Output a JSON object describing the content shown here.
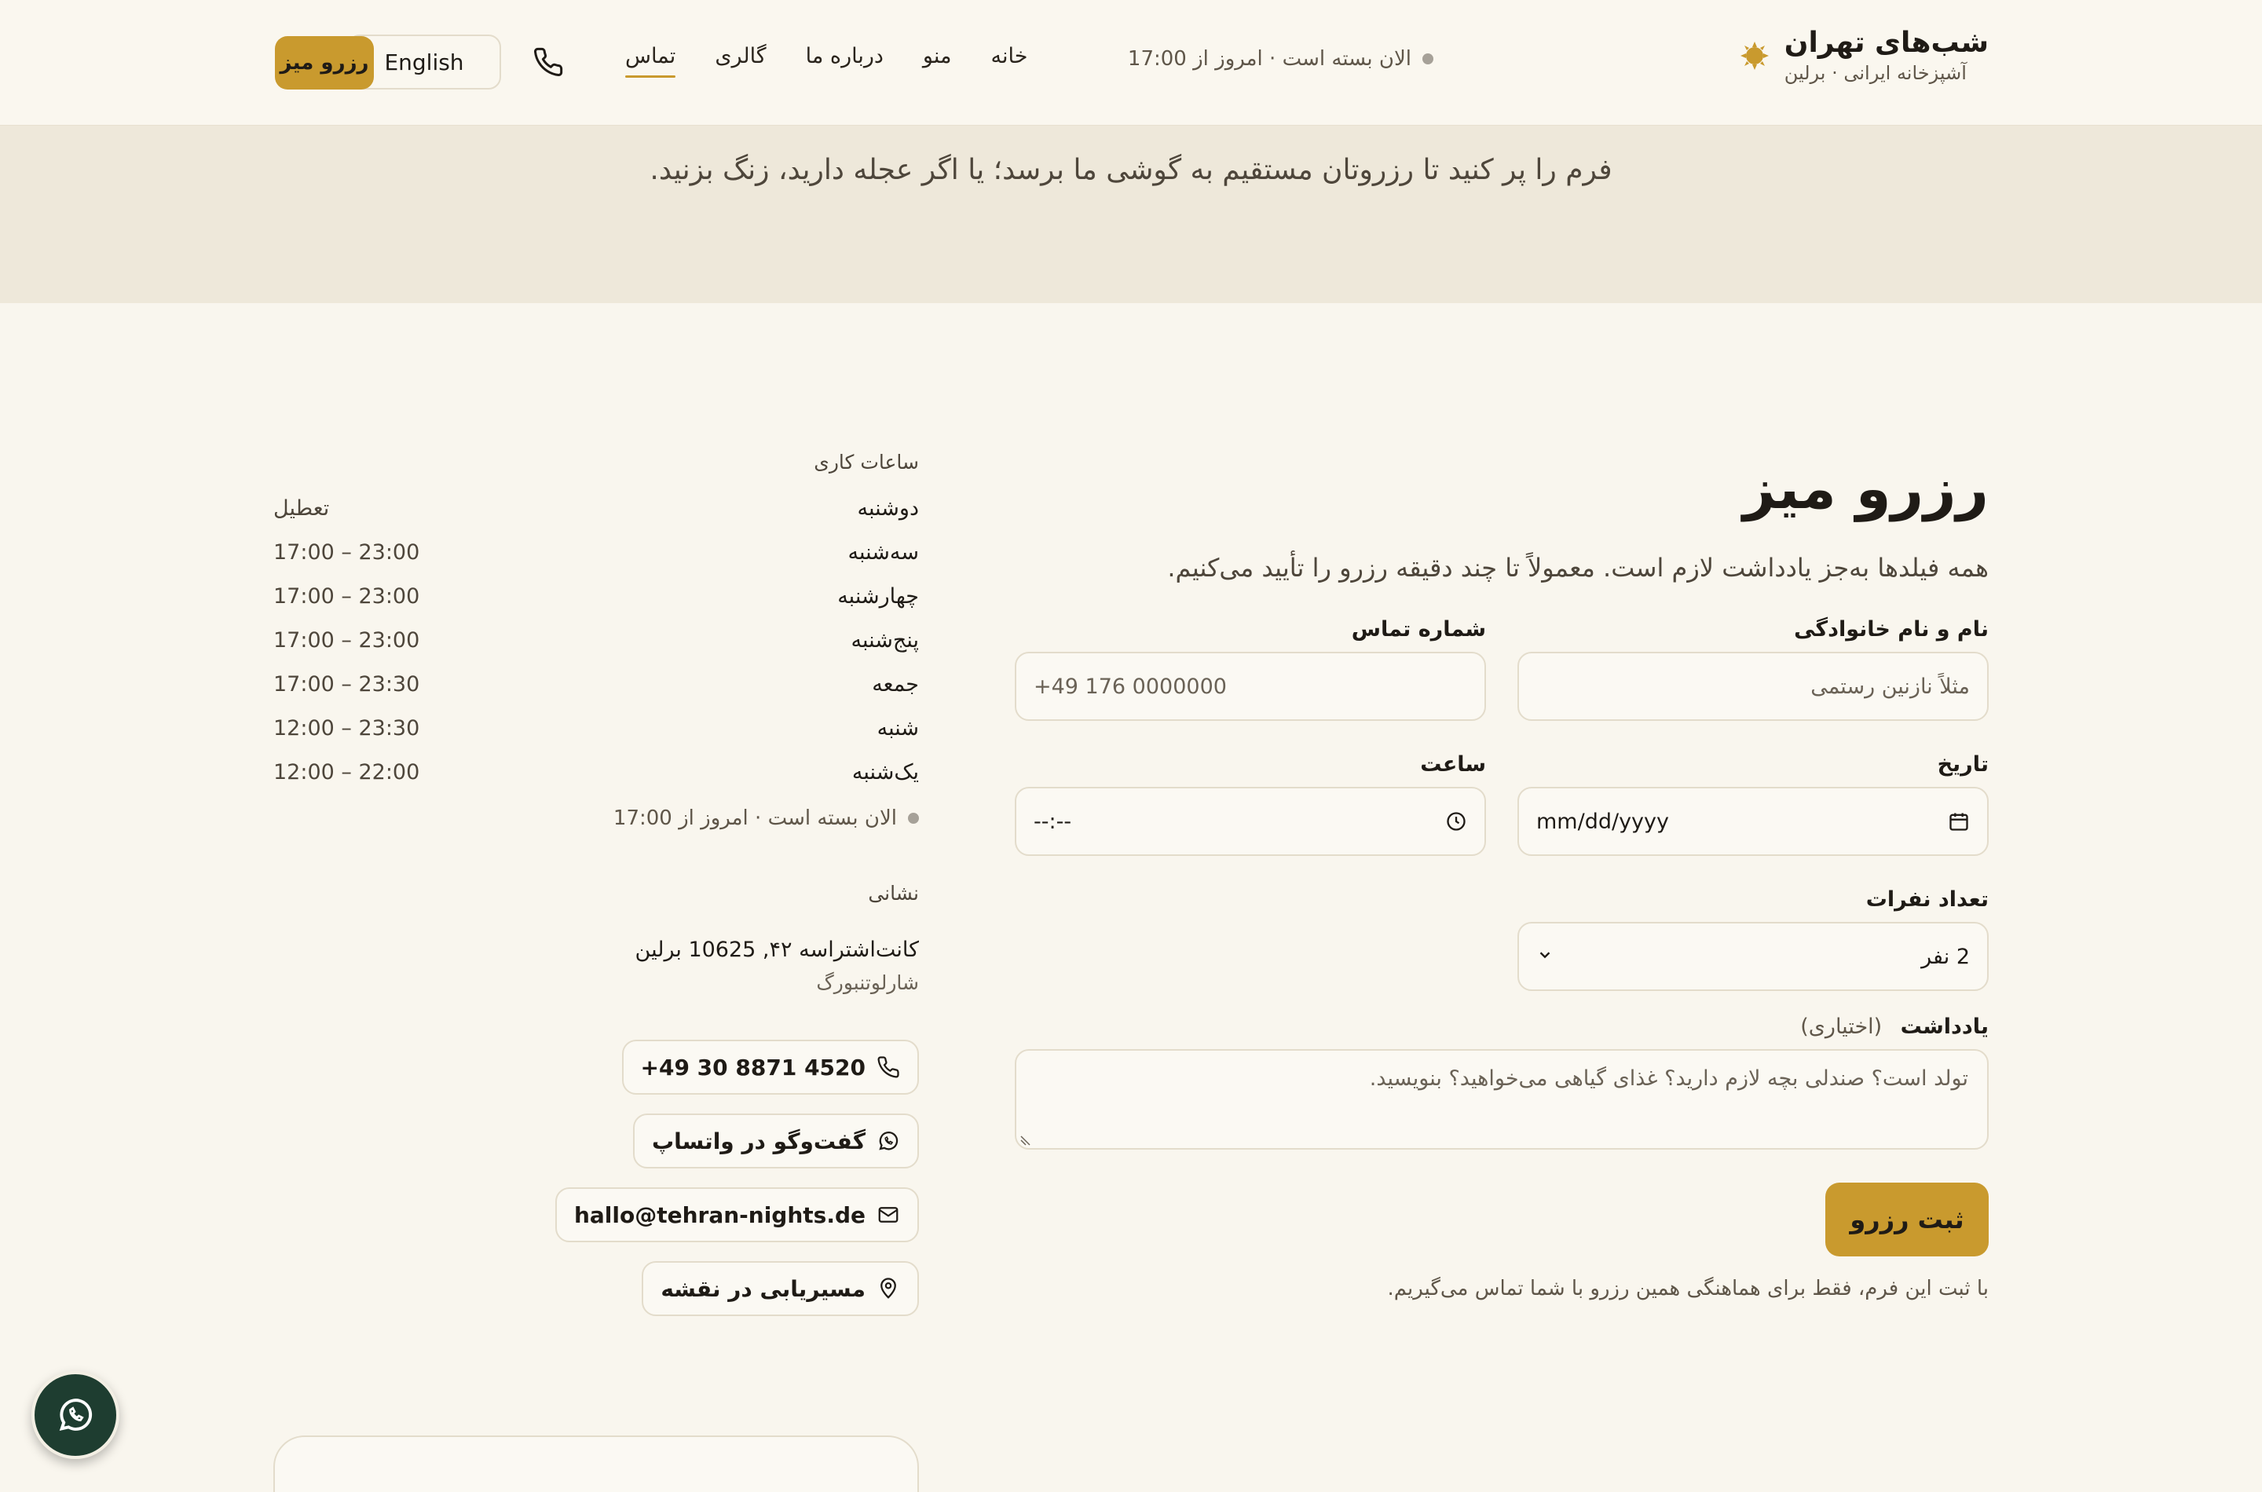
{
  "header": {
    "brand_name": "شب‌های تهران",
    "brand_sub": "آشپزخانه ایرانی · برلین",
    "status": "الان بسته است · امروز از 17:00",
    "nav": [
      {
        "label": "خانه"
      },
      {
        "label": "منو"
      },
      {
        "label": "درباره ما"
      },
      {
        "label": "گالری"
      },
      {
        "label": "تماس",
        "active": true
      }
    ],
    "lang_label": "English",
    "reserve_label": "رزرو میز"
  },
  "banner": {
    "text": "فرم را پر کنید تا رزروتان مستقیم به گوشی ما برسد؛ یا اگر عجله دارید، زنگ بزنید."
  },
  "form": {
    "title": "رزرو میز",
    "subtitle": "همه فیلدها به‌جز یادداشت لازم است. معمولاً تا چند دقیقه رزرو را تأیید می‌کنیم.",
    "name_label": "نام و نام خانوادگی",
    "name_placeholder": "مثلاً نازنین رستمی",
    "phone_label": "شماره تماس",
    "phone_placeholder": "+49 176 0000000",
    "date_label": "تاریخ",
    "date_placeholder": "mm/dd/yyyy",
    "time_label": "ساعت",
    "time_placeholder": "--:--",
    "guests_label": "تعداد نفرات",
    "guests_value": "2 نفر",
    "notes_label": "یادداشت",
    "notes_optional": "(اختیاری)",
    "notes_placeholder": "تولد است؟ صندلی بچه لازم دارید؟ غذای گیاهی می‌خواهید؟ بنویسید.",
    "submit_label": "ثبت رزرو",
    "footnote": "با ثبت این فرم، فقط برای هماهنگی همین رزرو با شما تماس می‌گیریم."
  },
  "side": {
    "hours_title": "ساعات کاری",
    "hours": [
      {
        "day": "دوشنبه",
        "time": "تعطیل"
      },
      {
        "day": "سه‌شنبه",
        "time": "17:00 – 23:00"
      },
      {
        "day": "چهارشنبه",
        "time": "17:00 – 23:00"
      },
      {
        "day": "پنج‌شنبه",
        "time": "17:00 – 23:00"
      },
      {
        "day": "جمعه",
        "time": "17:00 – 23:30"
      },
      {
        "day": "شنبه",
        "time": "12:00 – 23:30"
      },
      {
        "day": "یک‌شنبه",
        "time": "12:00 – 22:00"
      }
    ],
    "status": "الان بسته است · امروز از 17:00",
    "address_title": "نشانی",
    "address_line1": "کانت‌اشتراسه ۴۲, 10625 برلین",
    "address_line2": "شارلوتنبورگ",
    "phone": "+49 30 8871 4520",
    "whatsapp": "گفت‌وگو در واتساپ",
    "email": "hallo@tehran-nights.de",
    "map": "مسیریابی در نقشه"
  },
  "colors": {
    "accent": "#c99a2e",
    "background": "#f9f6ee",
    "banner": "#eee8da",
    "whatsapp_float": "#1e3d30"
  }
}
